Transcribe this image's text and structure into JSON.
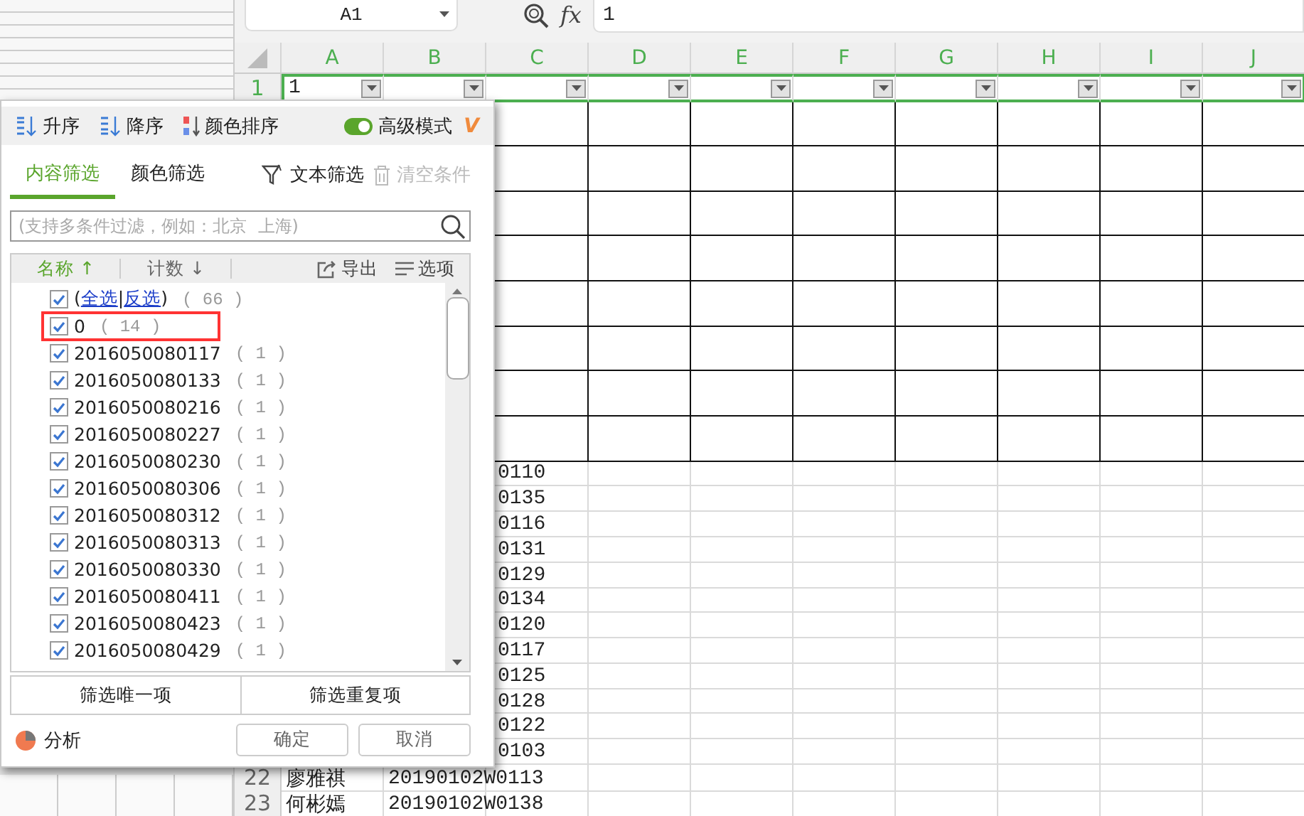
{
  "formula_bar": {
    "name_box": "A1",
    "fx": "fx",
    "formula": "1"
  },
  "columns": [
    "A",
    "B",
    "C",
    "D",
    "E",
    "F",
    "G",
    "H",
    "I",
    "J"
  ],
  "rows": [
    {
      "kind": "filter",
      "number": "1",
      "selected": true,
      "cells": {
        "A": "1"
      }
    },
    {
      "kind": "bordered"
    },
    {
      "kind": "bordered"
    },
    {
      "kind": "bordered"
    },
    {
      "kind": "bordered"
    },
    {
      "kind": "bordered"
    },
    {
      "kind": "bordered"
    },
    {
      "kind": "bordered"
    },
    {
      "kind": "bordered"
    },
    {
      "kind": "plain",
      "cells": {
        "C": "0110"
      }
    },
    {
      "kind": "plain",
      "cells": {
        "C": "0135"
      }
    },
    {
      "kind": "plain",
      "cells": {
        "C": "0116"
      }
    },
    {
      "kind": "plain",
      "cells": {
        "C": "0131"
      }
    },
    {
      "kind": "plain",
      "cells": {
        "C": "0129"
      }
    },
    {
      "kind": "plain",
      "cells": {
        "C": "0134"
      }
    },
    {
      "kind": "plain",
      "cells": {
        "C": "0120"
      }
    },
    {
      "kind": "plain",
      "cells": {
        "C": "0117"
      }
    },
    {
      "kind": "plain",
      "cells": {
        "C": "0125"
      }
    },
    {
      "kind": "plain",
      "cells": {
        "C": "0128"
      }
    },
    {
      "kind": "plain",
      "cells": {
        "C": "0122"
      }
    },
    {
      "kind": "plain",
      "cells": {
        "C": "0103"
      }
    },
    {
      "kind": "plain",
      "number": "22",
      "cells": {
        "A": "廖雅祺",
        "B": "20190102W0113"
      }
    },
    {
      "kind": "plain",
      "number": "23",
      "cells": {
        "A": "何彬嫣",
        "B": "20190102W0138"
      }
    }
  ],
  "filter_panel": {
    "sort": [
      {
        "label": "升序",
        "kind": "asc"
      },
      {
        "label": "降序",
        "kind": "desc"
      },
      {
        "label": "颜色排序",
        "kind": "color"
      }
    ],
    "advanced_mode": {
      "label": "高级模式",
      "on": true,
      "badge": "V"
    },
    "tabs": [
      {
        "label": "内容筛选",
        "selected": true
      },
      {
        "label": "颜色筛选",
        "selected": false
      }
    ],
    "actions": [
      {
        "label": "文本筛选",
        "kind": "text_filter",
        "disabled": false
      },
      {
        "label": "清空条件",
        "kind": "clear",
        "disabled": true
      }
    ],
    "search": {
      "placeholder": "(支持多条件过滤，例如：北京  上海)"
    },
    "list_header": {
      "columns": [
        {
          "label": "名称",
          "selected": true,
          "direction": "↑"
        },
        {
          "label": "计数",
          "selected": false,
          "direction": "↓"
        }
      ],
      "export": "导出",
      "options": "选项"
    },
    "select_all": {
      "open": "(",
      "select_all": "全选",
      "separator": "|",
      "invert": "反选",
      "close": ")",
      "count": "( 66 )",
      "checked": true
    },
    "items": [
      {
        "label": "0",
        "count": "( 14 )",
        "checked": true,
        "highlighted": true
      },
      {
        "label": "2016050080117",
        "count": "( 1 )",
        "checked": true,
        "highlighted": false
      },
      {
        "label": "2016050080133",
        "count": "( 1 )",
        "checked": true,
        "highlighted": false
      },
      {
        "label": "2016050080216",
        "count": "( 1 )",
        "checked": true,
        "highlighted": false
      },
      {
        "label": "2016050080227",
        "count": "( 1 )",
        "checked": true,
        "highlighted": false
      },
      {
        "label": "2016050080230",
        "count": "( 1 )",
        "checked": true,
        "highlighted": false
      },
      {
        "label": "2016050080306",
        "count": "( 1 )",
        "checked": true,
        "highlighted": false
      },
      {
        "label": "2016050080312",
        "count": "( 1 )",
        "checked": true,
        "highlighted": false
      },
      {
        "label": "2016050080313",
        "count": "( 1 )",
        "checked": true,
        "highlighted": false
      },
      {
        "label": "2016050080330",
        "count": "( 1 )",
        "checked": true,
        "highlighted": false
      },
      {
        "label": "2016050080411",
        "count": "( 1 )",
        "checked": true,
        "highlighted": false
      },
      {
        "label": "2016050080423",
        "count": "( 1 )",
        "checked": true,
        "highlighted": false
      },
      {
        "label": "2016050080429",
        "count": "( 1 )",
        "checked": true,
        "highlighted": false
      }
    ],
    "quick_buttons": [
      "筛选唯一项",
      "筛选重复项"
    ],
    "analysis": "分析",
    "buttons": [
      "确定",
      "取消"
    ]
  }
}
